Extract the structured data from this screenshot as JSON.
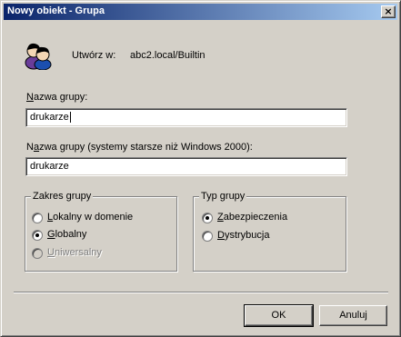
{
  "window": {
    "title": "Nowy obiekt - Grupa",
    "close_glyph": "×"
  },
  "header": {
    "icon": "group-users-icon",
    "create_in_label": "Utwórz w:",
    "create_in_value": "abc2.local/Builtin"
  },
  "form": {
    "group_name_label_u": "N",
    "group_name_label_rest": "azwa grupy:",
    "group_name_value": "drukarze",
    "legacy_name_label_pre": "N",
    "legacy_name_label_u": "a",
    "legacy_name_label_rest": "zwa grupy (systemy starsze niż Windows 2000):",
    "legacy_name_value": "drukarze"
  },
  "scope": {
    "title": "Zakres grupy",
    "options": [
      {
        "u": "L",
        "rest": "okalny w domenie",
        "checked": false,
        "disabled": false
      },
      {
        "u": "G",
        "rest": "lobalny",
        "checked": true,
        "disabled": false
      },
      {
        "u": "U",
        "rest": "niwersalny",
        "checked": false,
        "disabled": true
      }
    ]
  },
  "type": {
    "title": "Typ grupy",
    "options": [
      {
        "u": "Z",
        "rest": "abezpieczenia",
        "checked": true,
        "disabled": false
      },
      {
        "u": "D",
        "rest": "ystrybucja",
        "checked": false,
        "disabled": false
      }
    ]
  },
  "buttons": {
    "ok": "OK",
    "cancel": "Anuluj"
  }
}
